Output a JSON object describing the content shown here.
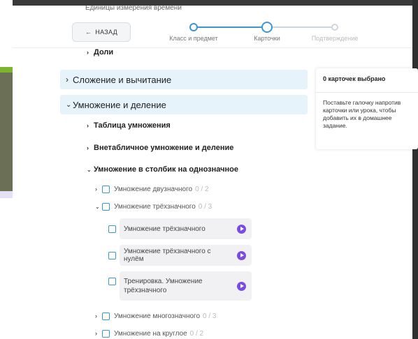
{
  "header": {
    "cut_text": "Единицы измерения времени",
    "back_label": "НАЗАД",
    "steps": [
      {
        "label": "Класс и предмет",
        "state": "done"
      },
      {
        "label": "Карточки",
        "state": "active"
      },
      {
        "label": "Подтверждение",
        "state": "pending"
      }
    ]
  },
  "tree": {
    "doli": "Доли",
    "sections": [
      {
        "label": "Сложение и вычитание",
        "expanded": false
      },
      {
        "label": "Умножение и деление",
        "expanded": true
      }
    ],
    "subsections": [
      {
        "label": "Таблица умножения"
      },
      {
        "label": "Внетабличное умножение и деление"
      },
      {
        "label": "Умножение в столбик на однозначное"
      }
    ],
    "topics": [
      {
        "label": "Умножение двузначного",
        "count": "0 / 2"
      },
      {
        "label": "Умножение трёхзначного",
        "count": "0 / 3"
      },
      {
        "label": "Умножение многозначного",
        "count": "0 / 3"
      },
      {
        "label": "Умножение на круглое",
        "count": "0 / 2"
      }
    ],
    "cards": [
      {
        "label": "Умножение трёхзначного"
      },
      {
        "label": "Умножение трёхзначного с нулём"
      },
      {
        "label": "Тренировка. Умножение трёхзначного"
      }
    ]
  },
  "side_panel": {
    "title": "0 карточек выбрано",
    "text": "Поставьте галочку напротив карточки или урока, чтобы добавить их в домашнее задание."
  },
  "colors": {
    "accent": "#3b96d8",
    "play": "#7b4ce0",
    "section_bg": "#e7f3fb"
  }
}
